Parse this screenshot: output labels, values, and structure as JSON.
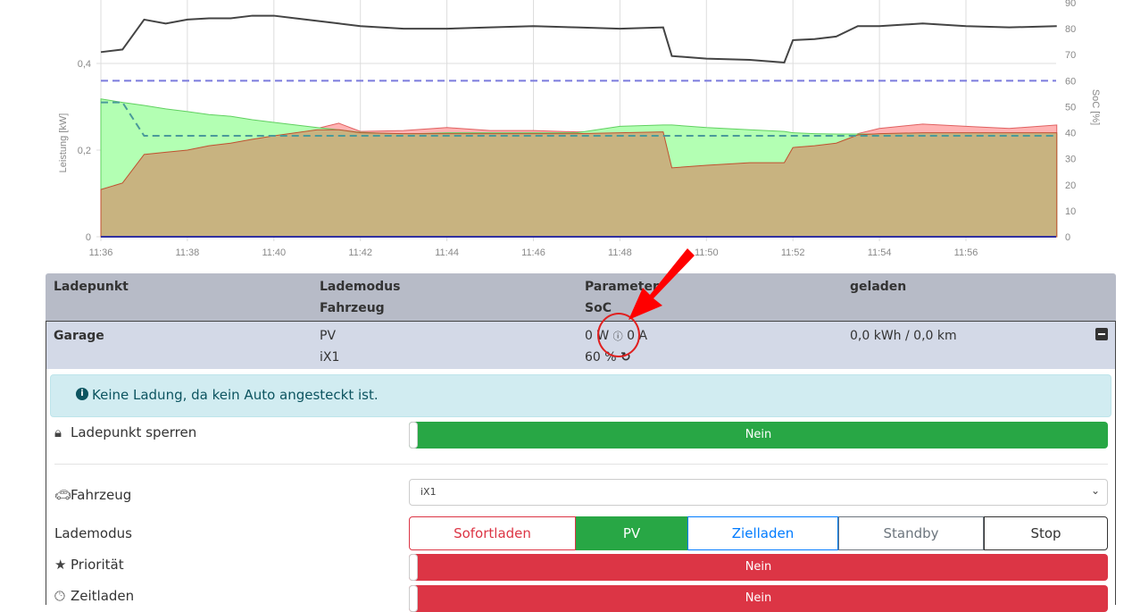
{
  "chart_data": {
    "type": "area",
    "ylabel_left": "Leistung [kW]",
    "ylabel_right": "SoC [%]",
    "ylim_left": [
      0,
      0.54
    ],
    "ylim_right": [
      0,
      90
    ],
    "yticks_left": [
      "0",
      "0,2",
      "0,4"
    ],
    "yticks_right": [
      "0",
      "10",
      "20",
      "30",
      "40",
      "50",
      "60",
      "70",
      "80",
      "90"
    ],
    "xticks": [
      "11:36",
      "11:38",
      "11:40",
      "11:42",
      "11:44",
      "11:46",
      "11:48",
      "11:50",
      "11:52",
      "11:54",
      "11:56"
    ],
    "x_minutes_after_1136": [
      0,
      0.5,
      1,
      1.5,
      2,
      2.5,
      3,
      3.5,
      4,
      4.5,
      5,
      5.5,
      6,
      7,
      8,
      9,
      10,
      11,
      12,
      13,
      13.2,
      14,
      15,
      15.8,
      16,
      16.5,
      17,
      17.5,
      18,
      19,
      20,
      21,
      22.1
    ],
    "series": [
      {
        "name": "red-area",
        "unit": "kW",
        "color": "#ffb3b3",
        "values": [
          0.109,
          0.124,
          0.19,
          0.195,
          0.2,
          0.21,
          0.216,
          0.225,
          0.233,
          0.245,
          0.25,
          0.262,
          0.243,
          0.245,
          0.252,
          0.245,
          0.245,
          0.242,
          0.243,
          0.245,
          0.159,
          0.165,
          0.171,
          0.171,
          0.206,
          0.21,
          0.216,
          0.238,
          0.25,
          0.26,
          0.255,
          0.25,
          0.258
        ]
      },
      {
        "name": "green-area",
        "unit": "kW",
        "color": "#b3ffb3",
        "values": [
          0.318,
          0.31,
          0.303,
          0.295,
          0.289,
          0.282,
          0.278,
          0.27,
          0.264,
          0.258,
          0.252,
          0.247,
          0.241,
          0.237,
          0.24,
          0.24,
          0.24,
          0.24,
          0.255,
          0.258,
          0.258,
          0.252,
          0.247,
          0.243,
          0.24,
          0.238,
          0.237,
          0.237,
          0.237,
          0.237,
          0.237,
          0.236,
          0.236
        ]
      },
      {
        "name": "brown-area",
        "unit": "kW",
        "color": "#c8b380",
        "values": [
          0.109,
          0.124,
          0.19,
          0.195,
          0.2,
          0.21,
          0.216,
          0.225,
          0.233,
          0.24,
          0.247,
          0.247,
          0.24,
          0.238,
          0.238,
          0.238,
          0.238,
          0.238,
          0.24,
          0.242,
          0.159,
          0.165,
          0.171,
          0.171,
          0.206,
          0.21,
          0.216,
          0.235,
          0.238,
          0.24,
          0.24,
          0.24,
          0.24
        ]
      },
      {
        "name": "soc-line",
        "unit": "%",
        "color": "#444444",
        "values": [
          71,
          72,
          83.5,
          82,
          83.5,
          84,
          84,
          85,
          85,
          84,
          83,
          82,
          81,
          80,
          80,
          80.5,
          81,
          80.5,
          80,
          80.5,
          69.5,
          68.5,
          68,
          67,
          75.6,
          76,
          77,
          81,
          81,
          82,
          81,
          80.5,
          81
        ]
      },
      {
        "name": "teal-dashed",
        "unit": "kW",
        "color": "#4a9a9a",
        "values": [
          0.31,
          0.31,
          0.233,
          0.233,
          0.233,
          0.233,
          0.233,
          0.233,
          0.233,
          0.233,
          0.233,
          0.233,
          0.233,
          0.233,
          0.233,
          0.233,
          0.233,
          0.233,
          0.233,
          0.233,
          0.233,
          0.233,
          0.233,
          0.233,
          0.233,
          0.233,
          0.233,
          0.233,
          0.233,
          0.233,
          0.233,
          0.233,
          0.233
        ]
      },
      {
        "name": "purple-dashed",
        "unit": "%",
        "color": "#7b7bdd",
        "values": [
          60,
          60
        ]
      }
    ]
  },
  "table": {
    "headers": {
      "col1": "Ladepunkt",
      "col2a": "Lademodus",
      "col2b": "Fahrzeug",
      "col3a": "Parameter",
      "col3b": "SoC",
      "col4": "geladen"
    },
    "row": {
      "name": "Garage",
      "mode": "PV",
      "vehicle": "iX1",
      "power": "0 W",
      "current": "0 A",
      "soc": "60 %",
      "charged": "0,0 kWh / 0,0 km"
    }
  },
  "panel": {
    "alert": "Keine Ladung, da kein Auto angesteckt ist.",
    "lock_label": "Ladepunkt sperren",
    "lock_value": "Nein",
    "vehicle_label": "Fahrzeug",
    "vehicle_value": "iX1",
    "mode_label": "Lademodus",
    "modes": [
      "Sofortladen",
      "PV",
      "Zielladen",
      "Standby",
      "Stop"
    ],
    "priority_label": "Priorität",
    "priority_value": "Nein",
    "timed_label": "Zeitladen",
    "timed_value": "Nein"
  },
  "colors": {
    "green": "#28a745",
    "red": "#dc3545",
    "blue": "#007bff",
    "grey": "#6c757d"
  }
}
